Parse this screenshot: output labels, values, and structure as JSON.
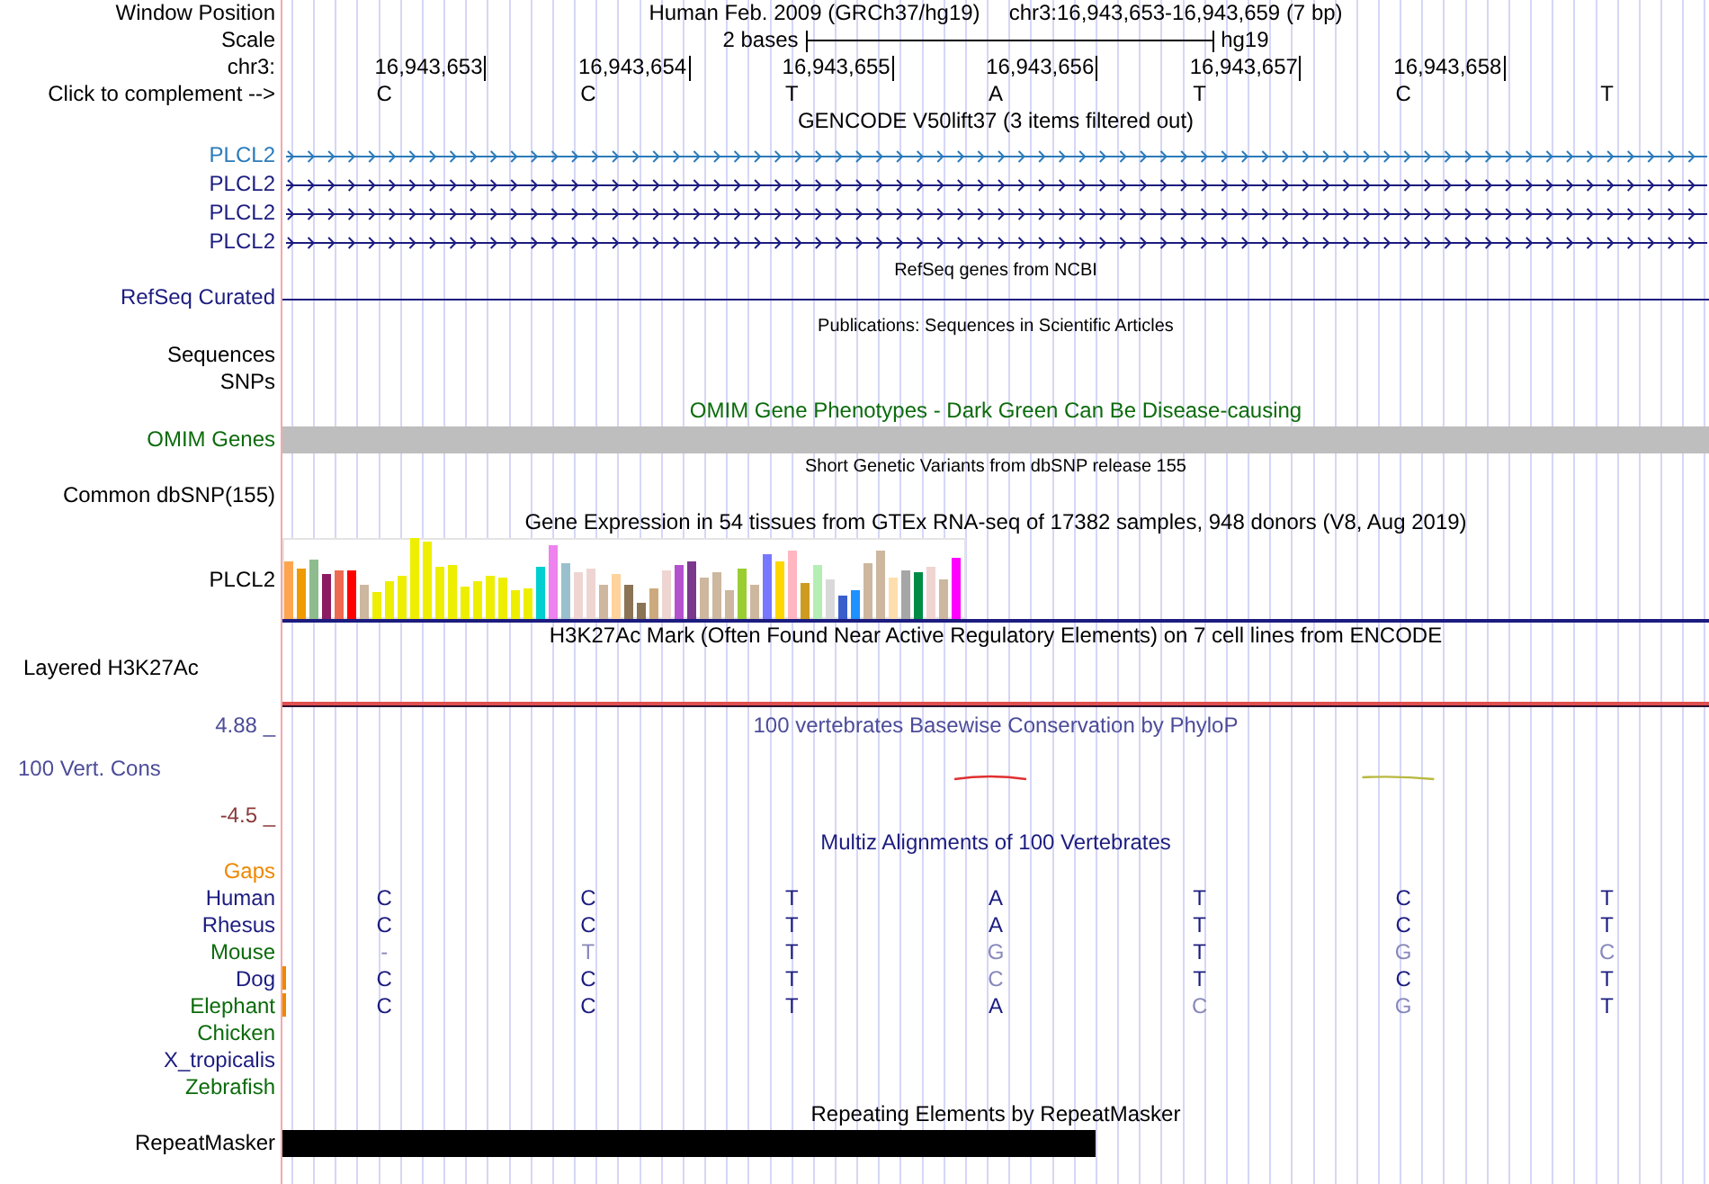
{
  "header": {
    "label": "Window Position",
    "assembly": "Human Feb. 2009 (GRCh37/hg19)",
    "position": "chr3:16,943,653-16,943,659 (7 bp)"
  },
  "scale": {
    "label": "Scale",
    "length": "2 bases",
    "assembly": "hg19"
  },
  "ruler": {
    "label": "chr3:",
    "positions": [
      "16,943,653",
      "16,943,654",
      "16,943,655",
      "16,943,656",
      "16,943,657",
      "16,943,658"
    ]
  },
  "sequence": {
    "label": "Click to complement -->",
    "bases": [
      "C",
      "C",
      "T",
      "A",
      "T",
      "C",
      "T"
    ]
  },
  "tracks": [
    {
      "kind": "gene",
      "title": "GENCODE V50lift37 (3 items filtered out)",
      "items": [
        {
          "name": "PLCL2",
          "color": "#2b7bba"
        },
        {
          "name": "PLCL2",
          "color": "#1c1c80"
        },
        {
          "name": "PLCL2",
          "color": "#1c1c80"
        },
        {
          "name": "PLCL2",
          "color": "#1c1c80"
        }
      ]
    },
    {
      "kind": "line",
      "title": "RefSeq genes from NCBI",
      "label": "RefSeq Curated"
    },
    {
      "kind": "labels",
      "title": "Publications: Sequences in Scientific Articles",
      "labels": [
        "Sequences",
        "SNPs"
      ]
    },
    {
      "kind": "bar",
      "title": "OMIM Gene Phenotypes - Dark Green Can Be Disease-causing",
      "label": "OMIM Genes"
    },
    {
      "kind": "labels",
      "title": "Short Genetic Variants from dbSNP release 155",
      "labels": [
        "Common dbSNP(155)"
      ]
    },
    {
      "kind": "expression",
      "title": "Gene Expression in 54 tissues from GTEx RNA-seq of 17382 samples, 948 donors (V8, Aug 2019)",
      "label": "PLCL2"
    },
    {
      "kind": "signal",
      "title": "H3K27Ac Mark (Often Found Near Active Regulatory Elements) on 7 cell lines from ENCODE",
      "label": "Layered H3K27Ac"
    },
    {
      "kind": "conservation",
      "title": "100 vertebrates Basewise Conservation by PhyloP",
      "max": "4.88 _",
      "label": "100 Vert. Cons",
      "min": "-4.5 _"
    },
    {
      "kind": "alignment",
      "title": "Multiz Alignments of 100 Vertebrates",
      "gaps": "Gaps",
      "species": [
        {
          "name": "Human",
          "color": "#1c1c80",
          "insertion": false,
          "bases": [
            {
              "base": "C",
              "match": true
            },
            {
              "base": "C",
              "match": true
            },
            {
              "base": "T",
              "match": true
            },
            {
              "base": "A",
              "match": true
            },
            {
              "base": "T",
              "match": true
            },
            {
              "base": "C",
              "match": true
            },
            {
              "base": "T",
              "match": true
            }
          ]
        },
        {
          "name": "Rhesus",
          "color": "#1c1c80",
          "insertion": false,
          "bases": [
            {
              "base": "C",
              "match": true
            },
            {
              "base": "C",
              "match": true
            },
            {
              "base": "T",
              "match": true
            },
            {
              "base": "A",
              "match": true
            },
            {
              "base": "T",
              "match": true
            },
            {
              "base": "C",
              "match": true
            },
            {
              "base": "T",
              "match": true
            }
          ]
        },
        {
          "name": "Mouse",
          "color": "#0b6b0b",
          "insertion": false,
          "bases": [
            {
              "base": "-",
              "match": false
            },
            {
              "base": "T",
              "match": false
            },
            {
              "base": "T",
              "match": true
            },
            {
              "base": "G",
              "match": false
            },
            {
              "base": "T",
              "match": true
            },
            {
              "base": "G",
              "match": false
            },
            {
              "base": "C",
              "match": false
            }
          ]
        },
        {
          "name": "Dog",
          "color": "#1c1c80",
          "insertion": true,
          "bases": [
            {
              "base": "C",
              "match": true
            },
            {
              "base": "C",
              "match": true
            },
            {
              "base": "T",
              "match": true
            },
            {
              "base": "C",
              "match": false
            },
            {
              "base": "T",
              "match": true
            },
            {
              "base": "C",
              "match": true
            },
            {
              "base": "T",
              "match": true
            }
          ]
        },
        {
          "name": "Elephant",
          "color": "#0b6b0b",
          "insertion": true,
          "bases": [
            {
              "base": "C",
              "match": true
            },
            {
              "base": "C",
              "match": true
            },
            {
              "base": "T",
              "match": true
            },
            {
              "base": "A",
              "match": true
            },
            {
              "base": "C",
              "match": false
            },
            {
              "base": "G",
              "match": false
            },
            {
              "base": "T",
              "match": true
            }
          ]
        },
        {
          "name": "Chicken",
          "color": "#0b6b0b",
          "insertion": false
        },
        {
          "name": "X_tropicalis",
          "color": "#1c1c80",
          "insertion": false
        },
        {
          "name": "Zebrafish",
          "color": "#0b6b0b",
          "insertion": false
        }
      ]
    },
    {
      "kind": "repeat",
      "title": "Repeating Elements by RepeatMasker",
      "label": "RepeatMasker"
    }
  ]
}
